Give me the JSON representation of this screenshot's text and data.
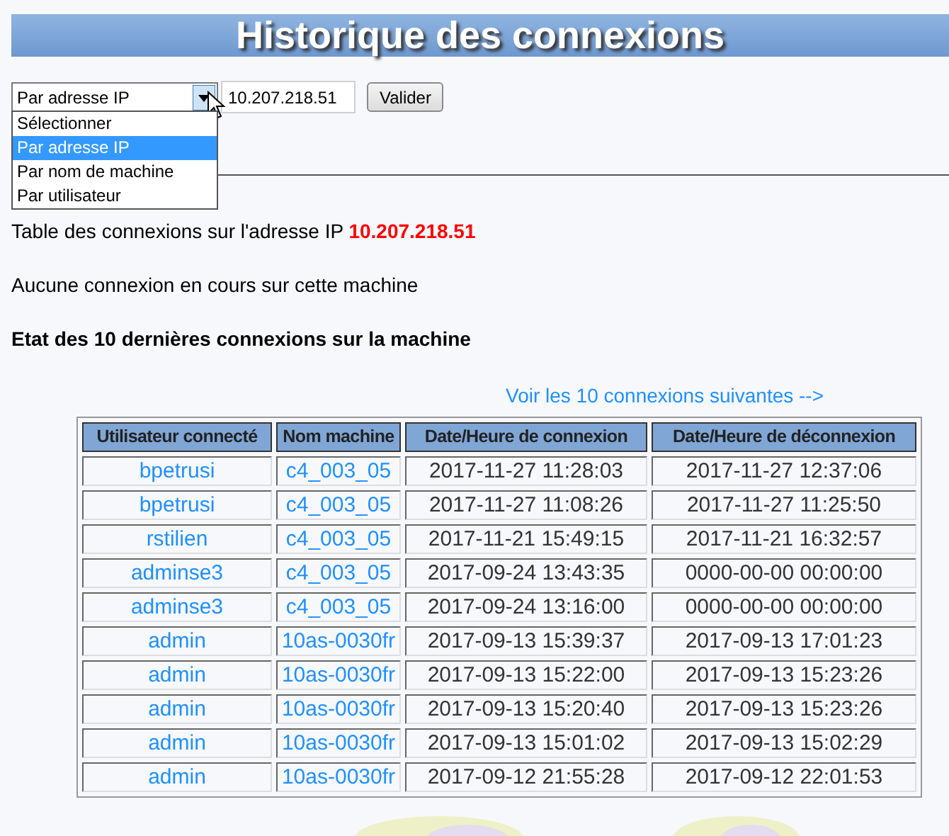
{
  "title": "Historique des connexions",
  "search": {
    "mode": "Par adresse IP",
    "expanded": true,
    "options": [
      {
        "label": "Sélectionner",
        "selected": false
      },
      {
        "label": "Par adresse IP",
        "selected": true
      },
      {
        "label": "Par nom de machine",
        "selected": false
      },
      {
        "label": "Par utilisateur",
        "selected": false
      }
    ],
    "value": "10.207.218.51",
    "button": "Valider"
  },
  "summary": "Table des connexions sur l'adresse IP **10.207.218.51**",
  "status": "Aucune connexion en cours sur cette machine",
  "heading": "Etat des 10 dernières connexions sur la machine",
  "next_link": "Voir les 10 connexions suivantes -->",
  "table": {
    "columns": [
      "Utilisateur connecté",
      "Nom machine",
      "Date/Heure de connexion",
      "Date/Heure de déconnexion"
    ],
    "rows": [
      [
        "bpetrusi",
        "c4_003_05",
        "2017-11-27 11:28:03",
        "2017-11-27 12:37:06"
      ],
      [
        "bpetrusi",
        "c4_003_05",
        "2017-11-27 11:08:26",
        "2017-11-27 11:25:50"
      ],
      [
        "rstilien",
        "c4_003_05",
        "2017-11-21 15:49:15",
        "2017-11-21 16:32:57"
      ],
      [
        "adminse3",
        "c4_003_05",
        "2017-09-24 13:43:35",
        "0000-00-00 00:00:00"
      ],
      [
        "adminse3",
        "c4_003_05",
        "2017-09-24 13:16:00",
        "0000-00-00 00:00:00"
      ],
      [
        "admin",
        "10as-0030fr",
        "2017-09-13 15:39:37",
        "2017-09-13 17:01:23"
      ],
      [
        "admin",
        "10as-0030fr",
        "2017-09-13 15:22:00",
        "2017-09-13 15:23:26"
      ],
      [
        "admin",
        "10as-0030fr",
        "2017-09-13 15:20:40",
        "2017-09-13 15:23:26"
      ],
      [
        "admin",
        "10as-0030fr",
        "2017-09-13 15:01:02",
        "2017-09-13 15:02:29"
      ],
      [
        "admin",
        "10as-0030fr",
        "2017-09-12 21:55:28",
        "2017-09-12 22:01:53"
      ]
    ]
  }
}
